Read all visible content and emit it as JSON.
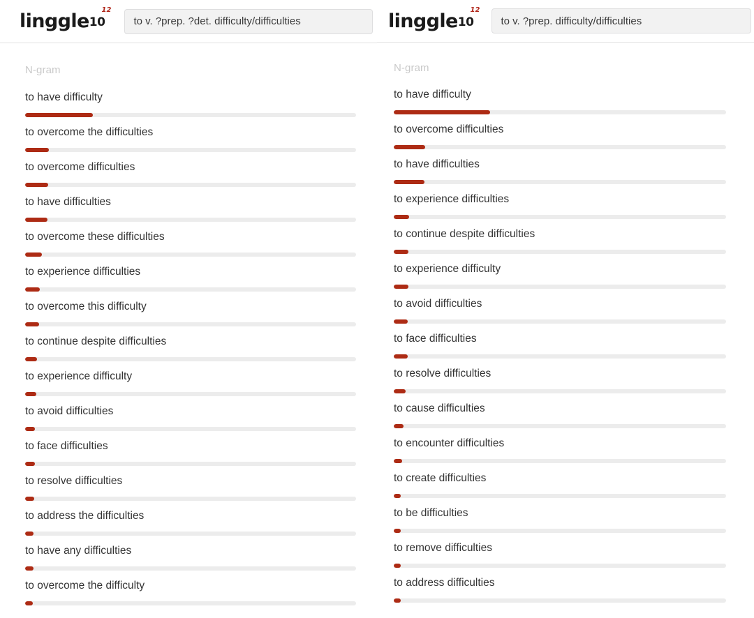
{
  "panels": [
    {
      "id": "left",
      "logo": {
        "word": "linggle",
        "ten": "10",
        "sup": "12"
      },
      "search": {
        "value": "to v. ?prep. ?det. difficulty/difficulties",
        "placeholder": "Enter a query"
      },
      "column_header": "N-gram",
      "chart_data": {
        "type": "bar",
        "title": "N-gram",
        "xlabel": "",
        "ylabel": "N-gram",
        "orientation": "horizontal",
        "grid": false,
        "legend": "none",
        "xlim": [
          0,
          100
        ],
        "categories": [
          "to have difficulty",
          "to overcome the difficulties",
          "to overcome difficulties",
          "to have difficulties",
          "to overcome these difficulties",
          "to experience difficulties",
          "to overcome this difficulty",
          "to continue despite difficulties",
          "to experience difficulty",
          "to avoid difficulties",
          "to face difficulties",
          "to resolve difficulties",
          "to address the difficulties",
          "to have any difficulties",
          "to overcome the difficulty"
        ],
        "values": [
          20.5,
          7.2,
          7.0,
          6.8,
          5.0,
          4.4,
          4.2,
          3.6,
          3.4,
          3.0,
          2.9,
          2.7,
          2.6,
          2.5,
          2.4
        ]
      }
    },
    {
      "id": "right",
      "logo": {
        "word": "linggle",
        "ten": "10",
        "sup": "12"
      },
      "search": {
        "value": "to v. ?prep. difficulty/difficulties",
        "placeholder": "Enter a query"
      },
      "column_header": "N-gram",
      "chart_data": {
        "type": "bar",
        "title": "N-gram",
        "xlabel": "",
        "ylabel": "N-gram",
        "orientation": "horizontal",
        "grid": false,
        "legend": "none",
        "xlim": [
          0,
          100
        ],
        "categories": [
          "to have difficulty",
          "to overcome difficulties",
          "to have difficulties",
          "to experience difficulties",
          "to continue despite difficulties",
          "to experience difficulty",
          "to avoid difficulties",
          "to face difficulties",
          "to resolve difficulties",
          "to cause difficulties",
          "to encounter difficulties",
          "to create difficulties",
          "to be difficulties",
          "to remove difficulties",
          "to address difficulties"
        ],
        "values": [
          29.0,
          9.5,
          9.2,
          4.6,
          4.5,
          4.4,
          4.3,
          4.2,
          3.6,
          3.0,
          2.6,
          2.2,
          2.2,
          2.1,
          2.0
        ]
      }
    }
  ],
  "colors": {
    "bar_fill": "#ad2b14",
    "bar_track": "#ececec",
    "logo_sup": "#b0261a",
    "text": "#343434",
    "muted": "#c9c9c9"
  }
}
